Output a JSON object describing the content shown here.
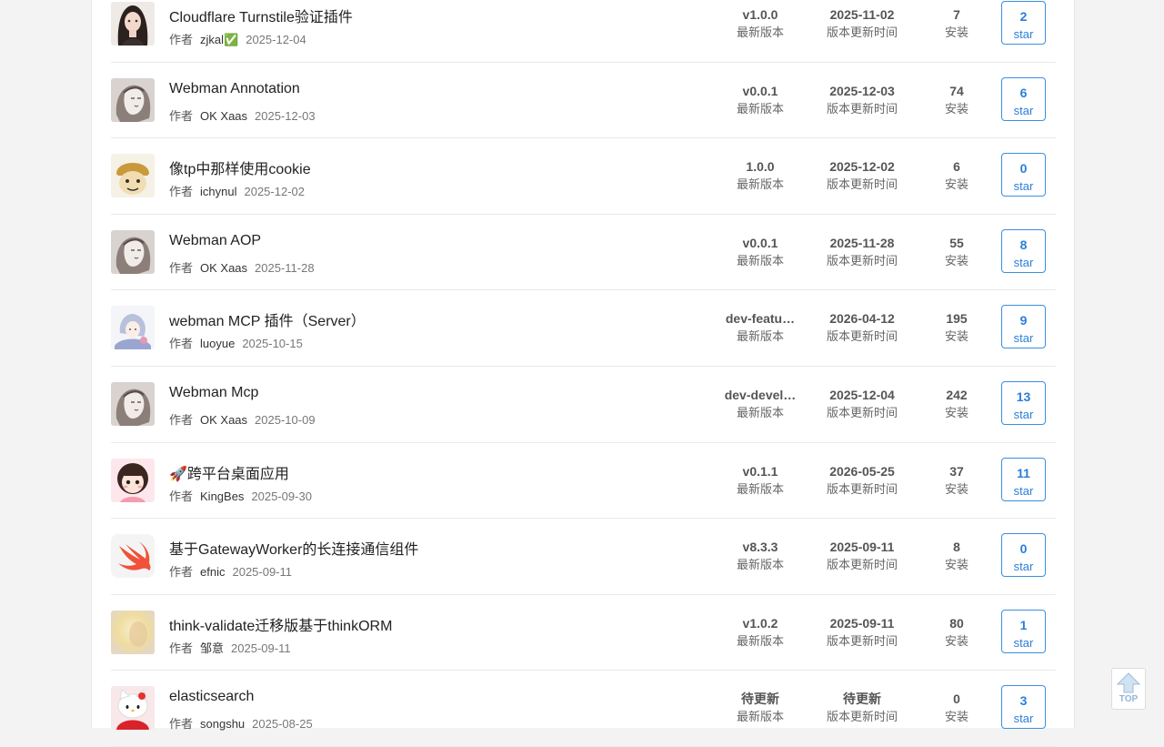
{
  "labels": {
    "author_prefix": "作者",
    "version_caption": "最新版本",
    "updated_caption": "版本更新时间",
    "install_caption": "安装",
    "star_caption": "star",
    "top_button": "TOP"
  },
  "plugins": [
    {
      "title": "Cloudflare Turnstile验证插件",
      "author": "zjkal✅",
      "date": "2025-12-04",
      "version": "v1.0.0",
      "updated": "2025-11-02",
      "installs": "7",
      "stars": "2",
      "avatar": "girl-portrait"
    },
    {
      "title": "Webman Annotation",
      "author": "OK Xaas",
      "date": "2025-12-03",
      "version": "v0.0.1",
      "updated": "2025-12-03",
      "installs": "74",
      "stars": "6",
      "avatar": "sketch-portrait"
    },
    {
      "title": "像tp中那样使用cookie",
      "author": "ichynul",
      "date": "2025-12-02",
      "version": "1.0.0",
      "updated": "2025-12-02",
      "installs": "6",
      "stars": "0",
      "avatar": "meme-face"
    },
    {
      "title": "Webman AOP",
      "author": "OK Xaas",
      "date": "2025-11-28",
      "version": "v0.0.1",
      "updated": "2025-11-28",
      "installs": "55",
      "stars": "8",
      "avatar": "sketch-portrait"
    },
    {
      "title": "webman MCP 插件（Server）",
      "author": "luoyue",
      "date": "2025-10-15",
      "version": "dev-featu…",
      "updated": "2026-04-12",
      "installs": "195",
      "stars": "9",
      "avatar": "anime-character"
    },
    {
      "title": "Webman Mcp",
      "author": "OK Xaas",
      "date": "2025-10-09",
      "version": "dev-devel…",
      "updated": "2025-12-04",
      "installs": "242",
      "stars": "13",
      "avatar": "sketch-portrait"
    },
    {
      "title": "🚀跨平台桌面应用",
      "author": "KingBes",
      "date": "2025-09-30",
      "version": "v0.1.1",
      "updated": "2026-05-25",
      "installs": "37",
      "stars": "11",
      "avatar": "cartoon-girl"
    },
    {
      "title": "基于GatewayWorker的长连接通信组件",
      "author": "efnic",
      "date": "2025-09-11",
      "version": "v8.3.3",
      "updated": "2025-09-11",
      "installs": "8",
      "stars": "0",
      "avatar": "swift-logo"
    },
    {
      "title": "think-validate迁移版基于thinkORM",
      "author": "邹意",
      "date": "2025-09-11",
      "version": "v1.0.2",
      "updated": "2025-09-11",
      "installs": "80",
      "stars": "1",
      "avatar": "blurred-photo"
    },
    {
      "title": "elasticsearch",
      "author": "songshu",
      "date": "2025-08-25",
      "version": "待更新",
      "updated": "待更新",
      "installs": "0",
      "stars": "3",
      "avatar": "hello-kitty"
    }
  ]
}
